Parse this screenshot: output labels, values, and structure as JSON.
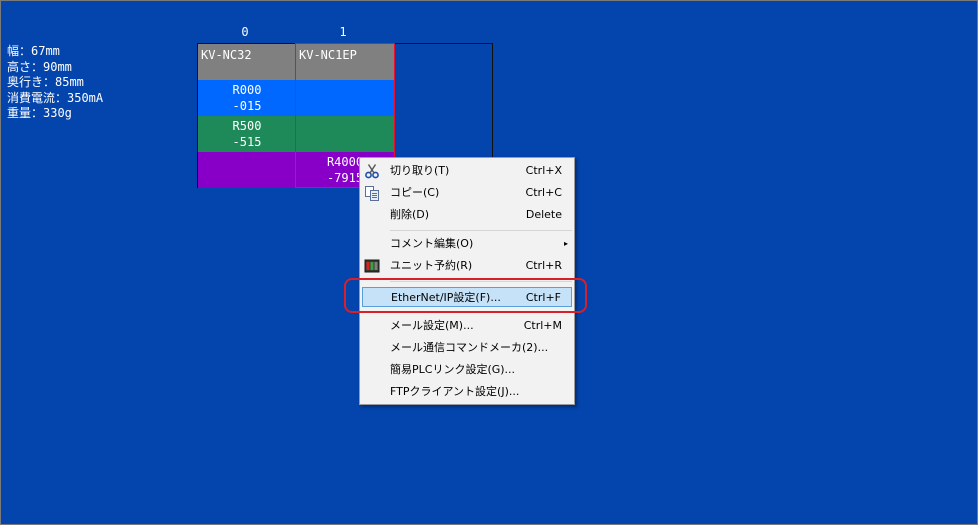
{
  "specs": [
    "幅：67mm",
    "高さ：90mm",
    "奥行き：85mm",
    "消費電流：350mA",
    "重量：330g"
  ],
  "slots": [
    "0",
    "1"
  ],
  "units": [
    {
      "name": "KV-NC32",
      "addr1": [
        "R000",
        "-015"
      ],
      "addr2": [
        "R500",
        "-515"
      ]
    },
    {
      "name": "KV-NC1EP",
      "addr3": [
        "R4000",
        "-7915"
      ]
    }
  ],
  "menu": {
    "items": [
      {
        "label": "切り取り(T)",
        "shortcut": "Ctrl+X",
        "icon": "scissors-icon"
      },
      {
        "label": "コピー(C)",
        "shortcut": "Ctrl+C",
        "icon": "copy-icon"
      },
      {
        "label": "削除(D)",
        "shortcut": "Delete"
      },
      {
        "label": "コメント編集(O)",
        "submenu": "▸"
      },
      {
        "label": "ユニット予約(R)",
        "shortcut": "Ctrl+R",
        "icon": "unit-reserve-icon"
      },
      {
        "label": "EtherNet/IP設定(F)...",
        "shortcut": "Ctrl+F"
      },
      {
        "label": "メール設定(M)...",
        "shortcut": "Ctrl+M"
      },
      {
        "label": "メール通信コマンドメーカ(2)..."
      },
      {
        "label": "簡易PLCリンク設定(G)..."
      },
      {
        "label": "FTPクライアント設定(J)..."
      }
    ]
  },
  "colors": {
    "background": "#0344ad",
    "highlight_ring": "#d8202a"
  }
}
